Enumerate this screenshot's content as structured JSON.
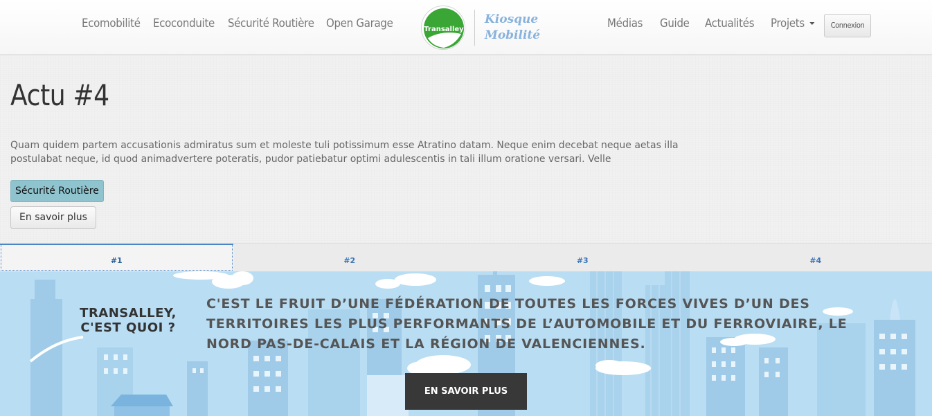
{
  "nav": {
    "left_links": [
      "Ecomobilité",
      "Ecoconduite",
      "Sécurité Routière",
      "Open Garage"
    ],
    "right_links": [
      "Médias",
      "Guide",
      "Actualités",
      "Projets"
    ],
    "logo_text": "Transalley",
    "brand_line1": "Kiosque",
    "brand_line2": "Mobilité",
    "login_label": "Connexion"
  },
  "article": {
    "title": "Actu #4",
    "intro": "Quam quidem partem accusationis admiratus sum et moleste tuli potissimum esse Atratino datam. Neque enim decebat neque aetas illa postulabat neque, id quod animadvertere poteratis, pudor patiebatur optimi adulescentis in tali illum oratione versari. Velle",
    "category": "Sécurité Routière",
    "more_label": "En savoir plus"
  },
  "tabs": [
    "#1",
    "#2",
    "#3",
    "#4"
  ],
  "banner": {
    "question": "TRANSALLEY, C'EST QUOI ?",
    "text": "C'EST LE FRUIT D’UNE FÉDÉRATION DE TOUTES LES FORCES VIVES D’UN DES TERRITOIRES LES PLUS PERFORMANTS DE L’AUTOMOBILE ET DU FERROVIAIRE, LE NORD PAS-DE-CALAIS ET LA RÉGION DE VALENCIENNES.",
    "button_label": "EN SAVOIR PLUS"
  },
  "colors": {
    "brand_green": "#3aa635",
    "brand_blue": "#89b3dc",
    "category_label": "#8fc4cf",
    "banner_sky": "#b9ddf3",
    "banner_button": "#383838"
  }
}
